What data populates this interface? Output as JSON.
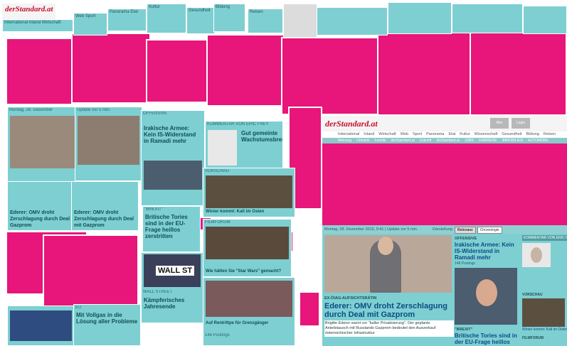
{
  "colors": {
    "magenta": "#e8157a",
    "teal": "#7ecfd2",
    "link": "#0c4b84"
  },
  "brand": {
    "logo": "derStandard.at"
  },
  "nav": {
    "main": [
      "International",
      "Inland",
      "Wirtschaft",
      "Web",
      "Sport",
      "Panorama",
      "Etat",
      "Kultur",
      "Wissenschaft",
      "Gesundheit",
      "Bildung",
      "Reisen"
    ],
    "sub": [
      "Meinung",
      "Lifestyle",
      "Familie",
      "Immobilien",
      "Automobil",
      "derStandard.at",
      "Zukunft",
      "dieStandard.at",
      "JOBS",
      "KARRIERE",
      "IMMOBILIEN",
      "AUTOMOBIL"
    ]
  },
  "header_badges": [
    "Abo",
    "Login"
  ],
  "datebar": {
    "date": "Montag, 28. Dezember 2015, 9:41 | Update vor 5 min.",
    "label": "Darstellung",
    "options": [
      "Relevanz",
      "Chronologie"
    ]
  },
  "lead": {
    "kicker": "EX-ÖIAG-AUFSICHTSRÄTIN",
    "headline": "Ederer: OMV droht Zerschlagung durch Deal mit Gazprom",
    "teaser": "Brigitte Ederer warnt vor \"kalter Privatisierung\". Der geplante Anteilstausch mit Russlands Gazprom bedeutet den Ausverkauf österreichischer Infrastruktur"
  },
  "second": {
    "section": "OFFENSIVE",
    "headline": "Irakische Armee: Kein IS-Widerstand in Ramadi mehr",
    "meta": "148 Postings",
    "section2": "\"BREXIT\"",
    "headline2": "Britische Tories sind in der EU-Frage heillos zerstritten"
  },
  "sidebar": {
    "comment_header": "KOMMENTAR VON ERIC FREY",
    "comment_title": "Gut gemeinte Wachstumsbremse",
    "preview_header": "VORSCHAU",
    "preview_caption": "Winter kommt: Kalt im Osten",
    "film_header": "FILMFORUM"
  },
  "fragments": {
    "wallstreet_sign": "WALL ST",
    "wallstreet_kicker": "WALL STREET",
    "wallstreet_text": "Kämpferisches Jahresende",
    "eu_kicker": "EU",
    "eu_text": "Mit Vollgas in die Lösung aller Probleme",
    "film_text": "Wie hätten Sie \"Star Wars\" gemacht?",
    "starwars_text": "Auf Rentrittpe für Grenzgänger",
    "date_small": "Montag, 28. Dezember",
    "update_small": "Update vor 5 min.",
    "posting_small": "148 Postings",
    "tories_text": "Britische Tories sind in der EU-Frage heillos zerstritten"
  }
}
